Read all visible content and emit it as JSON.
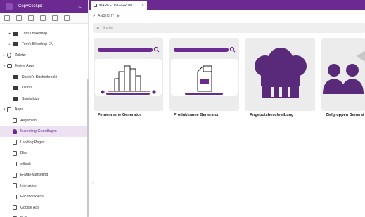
{
  "sidebar": {
    "app_title": "CopyCockpit",
    "items": [
      {
        "label": "Tom's Bikeshop",
        "level": 1,
        "icon": "folder-icon",
        "expand": "▸"
      },
      {
        "label": "Tom's Bikeshop EN",
        "level": 1,
        "icon": "folder-icon",
        "expand": "▸"
      },
      {
        "label": "Zuletzt",
        "level": 0,
        "icon": "clock-icon",
        "expand": "▸"
      },
      {
        "label": "Meine Apps",
        "level": 0,
        "icon": "heart-icon",
        "expand": "▾"
      },
      {
        "label": "Daniel's Bücherbrocki",
        "level": 1,
        "icon": "folder-icon",
        "expand": ""
      },
      {
        "label": "Demo",
        "level": 1,
        "icon": "folder-icon",
        "expand": ""
      },
      {
        "label": "Spielplätze",
        "level": 1,
        "icon": "folder-icon",
        "expand": ""
      },
      {
        "label": "Apps",
        "level": 0,
        "icon": "doc-icon",
        "expand": "▾"
      },
      {
        "label": "Allgemein",
        "level": 1,
        "icon": "doc-icon",
        "expand": ""
      },
      {
        "label": "Marketing-Grundlagen",
        "level": 1,
        "icon": "person-icon",
        "expand": "",
        "selected": true
      },
      {
        "label": "Landing Pages",
        "level": 1,
        "icon": "doc-icon",
        "expand": ""
      },
      {
        "label": "Blog",
        "level": 1,
        "icon": "doc-icon",
        "expand": ""
      },
      {
        "label": "eBook",
        "level": 1,
        "icon": "doc-icon",
        "expand": ""
      },
      {
        "label": "E-Mail-Marketing",
        "level": 1,
        "icon": "doc-icon",
        "expand": ""
      },
      {
        "label": "Interaktion",
        "level": 1,
        "icon": "doc-icon",
        "expand": ""
      },
      {
        "label": "Facebook Ads",
        "level": 1,
        "icon": "doc-icon",
        "expand": ""
      },
      {
        "label": "Google Ads",
        "level": 1,
        "icon": "doc-icon",
        "expand": ""
      },
      {
        "label": "E-Commerce",
        "level": 1,
        "icon": "doc-icon",
        "expand": ""
      }
    ]
  },
  "tab": {
    "label": "MARKETING-GRUND...",
    "close": "×"
  },
  "view": {
    "label": "ANSICHT",
    "glyph": "⊕"
  },
  "search": {
    "placeholder": "Suche",
    "glyph": "⌕"
  },
  "cards": [
    {
      "label": "Firmenname Generator",
      "illustration": "buildings-illustration"
    },
    {
      "label": "Produktname Generator",
      "illustration": "milk-carton-illustration"
    },
    {
      "label": "Angebotsbeschreibung",
      "illustration": "chef-hat-illustration"
    },
    {
      "label": "Zielgruppen Generat",
      "illustration": "people-illustration"
    }
  ],
  "colors": {
    "accent": "#6a2a8f",
    "card_bg": "#ececec"
  }
}
